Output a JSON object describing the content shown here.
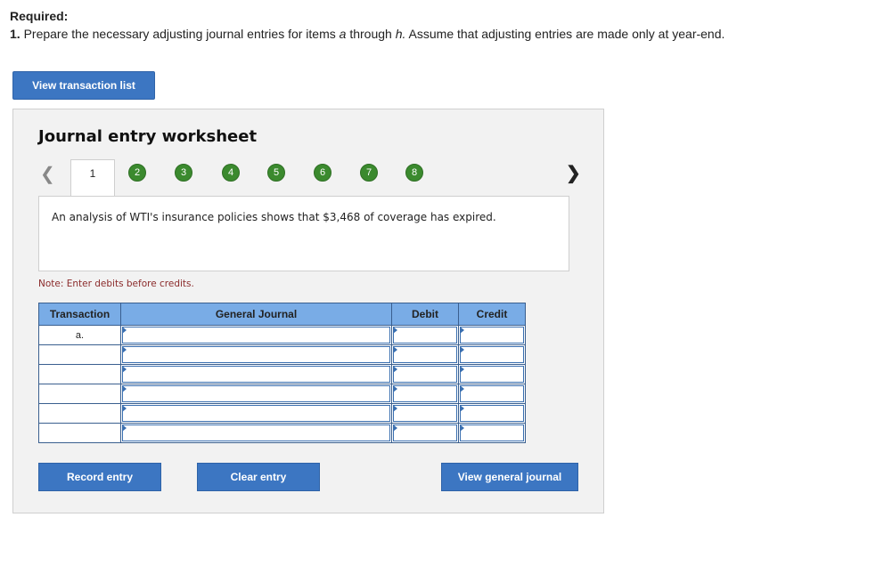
{
  "header": {
    "required_label": "Required:",
    "instruction_number": "1.",
    "instruction_part1": "Prepare the necessary adjusting journal entries for items",
    "item_start": "a",
    "instruction_through": "through",
    "item_end": "h.",
    "instruction_part2": "Assume that adjusting entries are made only at year-end."
  },
  "buttons": {
    "view_transaction_list": "View transaction list",
    "record_entry": "Record entry",
    "clear_entry": "Clear entry",
    "view_general_journal": "View general journal"
  },
  "worksheet": {
    "title": "Journal entry worksheet",
    "prev_icon": "chevron-left-icon",
    "next_icon": "chevron-right-icon",
    "active_tab": "1",
    "steps": [
      "2",
      "3",
      "4",
      "5",
      "6",
      "7",
      "8"
    ],
    "description": "An analysis of WTI's insurance policies shows that $3,468 of coverage has expired.",
    "note": "Note: Enter debits before credits."
  },
  "journal": {
    "columns": [
      "Transaction",
      "General Journal",
      "Debit",
      "Credit"
    ],
    "rows": [
      {
        "transaction": "a."
      },
      {
        "transaction": ""
      },
      {
        "transaction": ""
      },
      {
        "transaction": ""
      },
      {
        "transaction": ""
      },
      {
        "transaction": ""
      }
    ]
  },
  "colors": {
    "button_blue": "#3c76c2",
    "step_green": "#3b8a2e",
    "header_blue": "#79ace6",
    "note_red": "#8b2b2b"
  }
}
